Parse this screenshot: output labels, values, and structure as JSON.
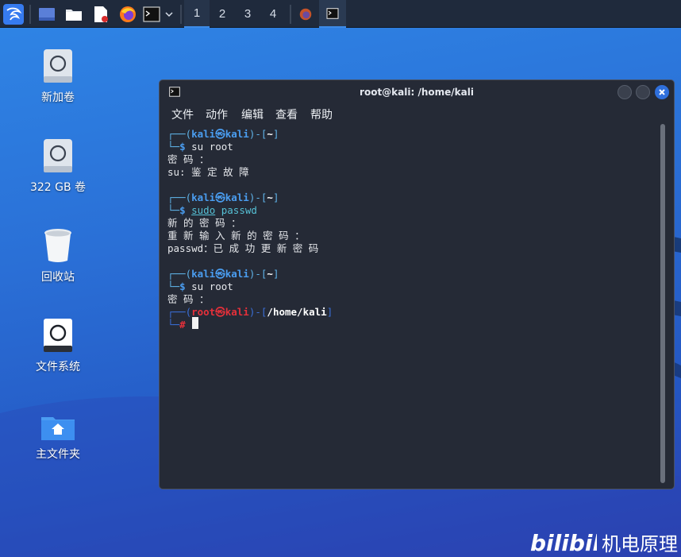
{
  "taskbar": {
    "workspaces": [
      "1",
      "2",
      "3",
      "4"
    ],
    "active_workspace": "1"
  },
  "desktop": {
    "icons": [
      {
        "label": "新加卷",
        "icon": "drive-icon"
      },
      {
        "label": "322 GB 卷",
        "icon": "drive-icon"
      },
      {
        "label": "回收站",
        "icon": "trash-icon"
      },
      {
        "label": "文件系统",
        "icon": "filesystem-icon"
      },
      {
        "label": "主文件夹",
        "icon": "home-folder-icon"
      }
    ]
  },
  "terminal": {
    "title": "root@kali: /home/kali",
    "menu": [
      "文件",
      "动作",
      "编辑",
      "查看",
      "帮助"
    ],
    "lines": {
      "p1_user": "kali",
      "p1_host": "kali",
      "p1_dir": "~",
      "cmd1": "su root",
      "out1": "密 码 ：",
      "out2": "su: 鉴 定 故 障",
      "p2_user": "kali",
      "p2_host": "kali",
      "p2_dir": "~",
      "cmd2_sudo": "sudo",
      "cmd2_rest": " passwd",
      "out3": "新 的 密 码 ：",
      "out4": "重 新 输 入 新 的 密 码 ：",
      "out5": "passwd：已 成 功 更 新 密 码",
      "p3_user": "kali",
      "p3_host": "kali",
      "p3_dir": "~",
      "cmd3": "su root",
      "out6": "密 码 ：",
      "p4_user": "root",
      "p4_host": "kali",
      "p4_dir": "/home/kali"
    }
  },
  "watermark": {
    "brand": "bilibili",
    "text": "机电原理"
  },
  "colors": {
    "accent": "#3d8be8",
    "close_button": "#2f6fdc",
    "prompt_user": "#4a9df0",
    "root_user": "#e5303a"
  }
}
